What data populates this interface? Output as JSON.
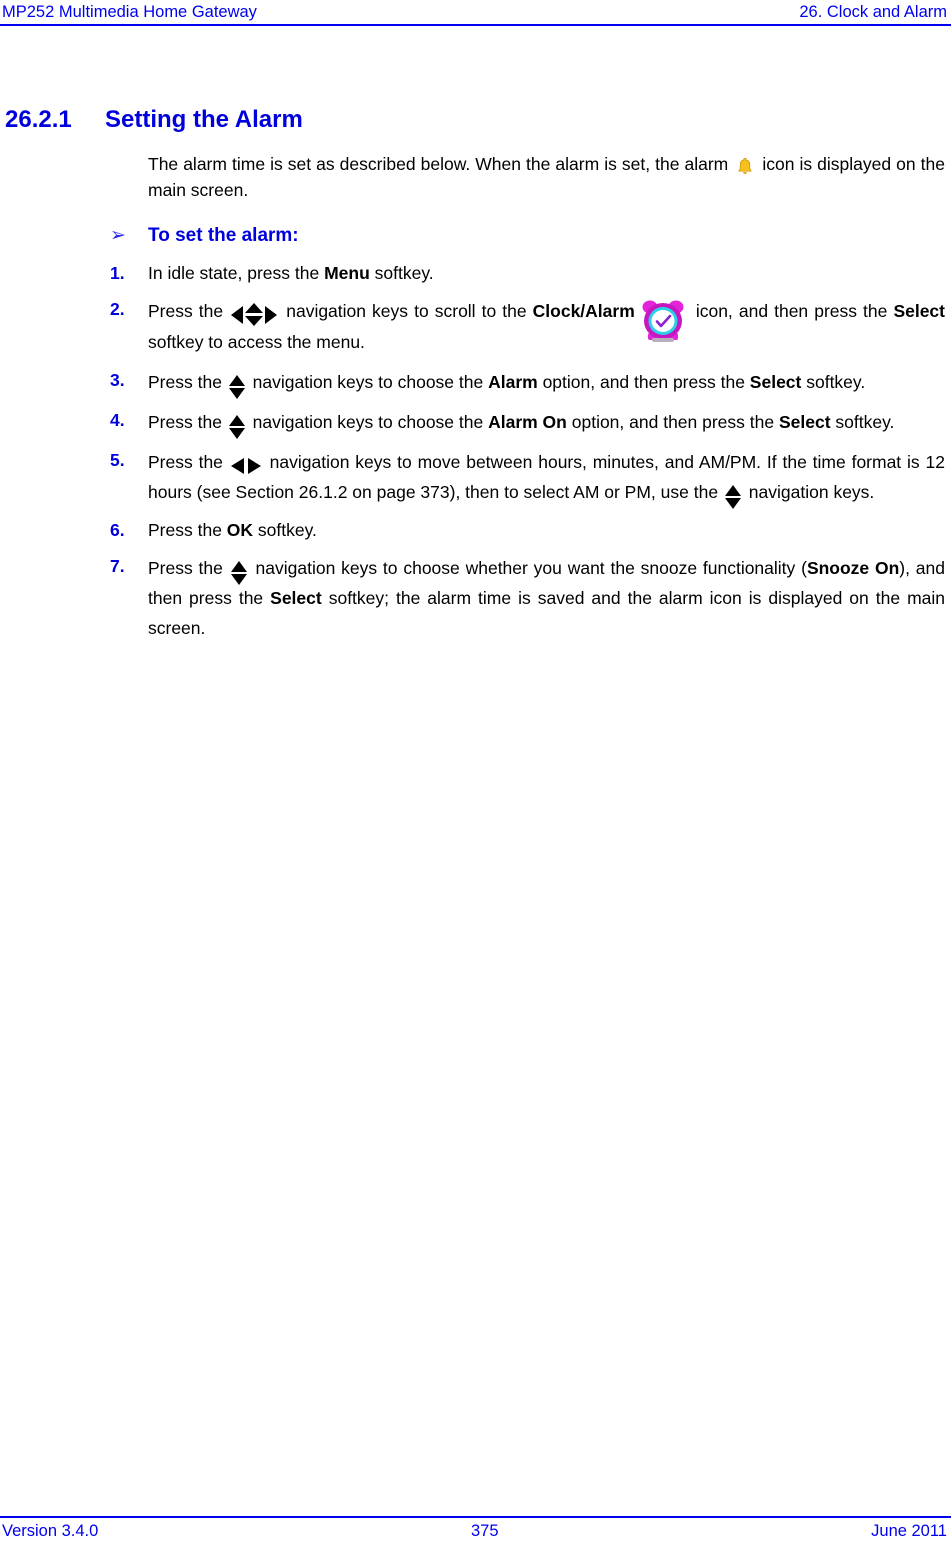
{
  "header": {
    "left": "MP252 Multimedia Home Gateway",
    "right": "26. Clock and Alarm"
  },
  "section": {
    "number": "26.2.1",
    "title": "Setting the Alarm"
  },
  "intro": {
    "part1": "The alarm time is set as described below. When the alarm is set, the alarm",
    "part2": "icon is displayed on the main screen."
  },
  "procedure": {
    "arrow_glyph": "➢",
    "lead_in": "To set the alarm:",
    "steps": [
      {
        "number": "1.",
        "segments": [
          {
            "type": "text",
            "value": "In idle state, press the "
          },
          {
            "type": "bold",
            "value": "Menu"
          },
          {
            "type": "text",
            "value": " softkey."
          }
        ]
      },
      {
        "number": "2.",
        "segments": [
          {
            "type": "text",
            "value": "Press the "
          },
          {
            "type": "icon",
            "value": "nav-4way-icon"
          },
          {
            "type": "text",
            "value": " navigation keys to scroll to the "
          },
          {
            "type": "bold",
            "value": "Clock/Alarm"
          },
          {
            "type": "icon",
            "value": "clock-alarm-icon"
          },
          {
            "type": "text",
            "value": " icon, and then press the "
          },
          {
            "type": "bold",
            "value": "Select"
          },
          {
            "type": "text",
            "value": " softkey to access the menu."
          }
        ]
      },
      {
        "number": "3.",
        "segments": [
          {
            "type": "text",
            "value": "Press the "
          },
          {
            "type": "icon",
            "value": "nav-up-down-icon"
          },
          {
            "type": "text",
            "value": " navigation keys to choose the "
          },
          {
            "type": "bold",
            "value": "Alarm"
          },
          {
            "type": "text",
            "value": " option, and then press the "
          },
          {
            "type": "bold",
            "value": "Select"
          },
          {
            "type": "text",
            "value": " softkey."
          }
        ]
      },
      {
        "number": "4.",
        "segments": [
          {
            "type": "text",
            "value": "Press the "
          },
          {
            "type": "icon",
            "value": "nav-up-down-icon"
          },
          {
            "type": "text",
            "value": " navigation keys to choose the "
          },
          {
            "type": "bold",
            "value": "Alarm On"
          },
          {
            "type": "text",
            "value": " option, and then press the "
          },
          {
            "type": "bold",
            "value": "Select"
          },
          {
            "type": "text",
            "value": " softkey."
          }
        ]
      },
      {
        "number": "5.",
        "segments": [
          {
            "type": "text",
            "value": "Press the "
          },
          {
            "type": "icon",
            "value": "nav-left-right-icon"
          },
          {
            "type": "text",
            "value": " navigation keys to move between hours, minutes, and AM/PM. If the time format is 12 hours (see Section 26.1.2 on page 373), then to select AM or PM, use the "
          },
          {
            "type": "icon",
            "value": "nav-up-down-icon"
          },
          {
            "type": "text",
            "value": " navigation keys."
          }
        ]
      },
      {
        "number": "6.",
        "segments": [
          {
            "type": "text",
            "value": "Press the "
          },
          {
            "type": "bold",
            "value": "OK"
          },
          {
            "type": "text",
            "value": " softkey."
          }
        ]
      },
      {
        "number": "7.",
        "segments": [
          {
            "type": "text",
            "value": "Press the "
          },
          {
            "type": "icon",
            "value": "nav-up-down-icon"
          },
          {
            "type": "text",
            "value": " navigation keys to choose whether you want the snooze functionality ("
          },
          {
            "type": "bold",
            "value": "Snooze On"
          },
          {
            "type": "text",
            "value": "), and then press the "
          },
          {
            "type": "bold",
            "value": "Select"
          },
          {
            "type": "text",
            "value": " softkey; the alarm time is saved and the alarm icon is displayed on the main screen."
          }
        ]
      }
    ]
  },
  "footer": {
    "version": "Version 3.4.0",
    "page_number": "375",
    "date": "June 2011"
  },
  "colors": {
    "heading_blue": "#0000dd",
    "header_footer_blue": "#0000ee",
    "body_black": "#000000",
    "bell_yellow": "#f5c21b",
    "clock_magenta": "#e324d8",
    "clock_face_cyan": "#28d2e8"
  }
}
